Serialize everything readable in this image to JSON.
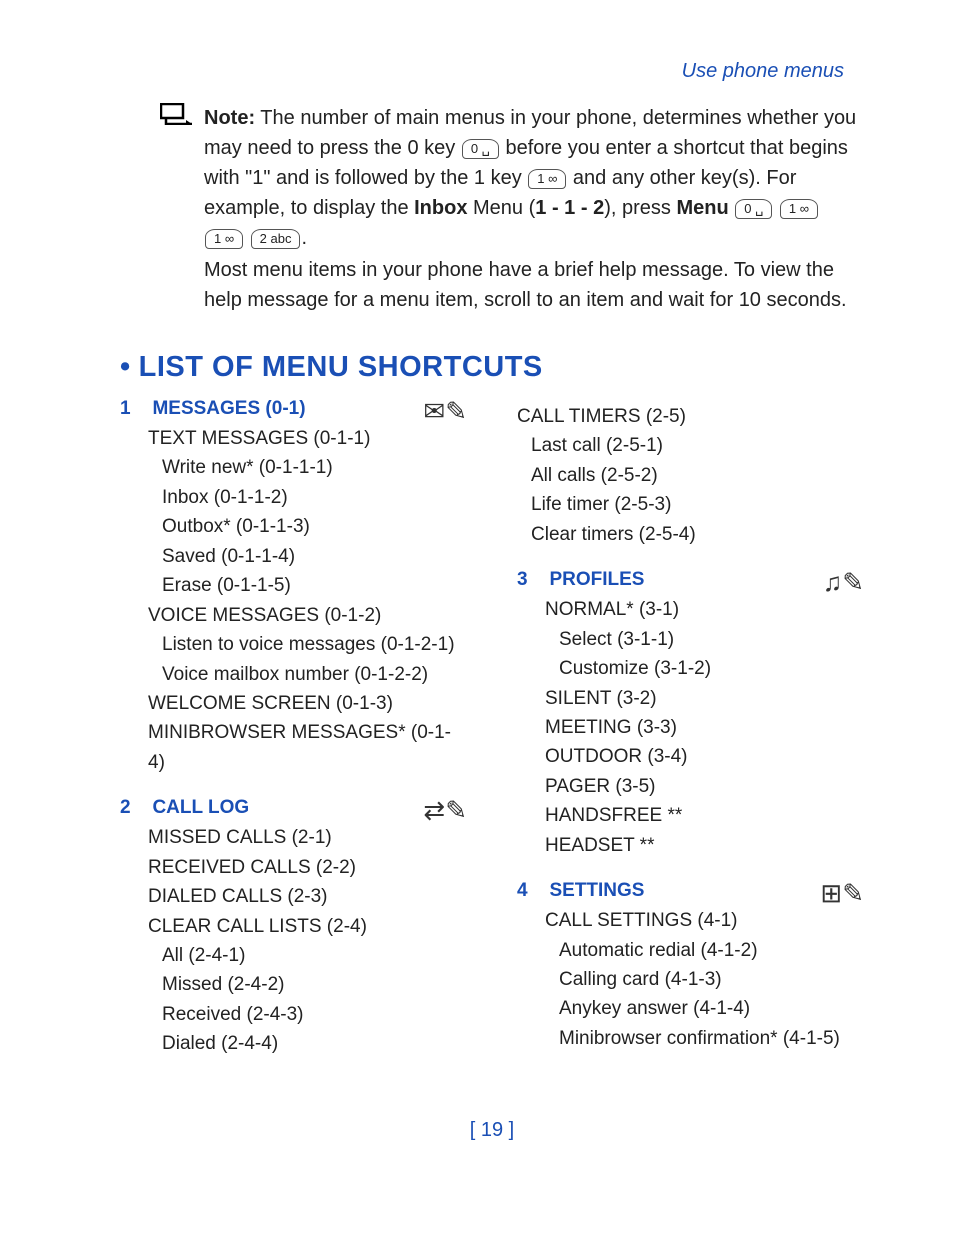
{
  "header": {
    "link": "Use phone menus"
  },
  "note": {
    "label": "Note:",
    "p1a": " The number of main menus in your phone, determines whether you may need to press the 0 key ",
    "key0": "0 ␣",
    "p1b": " before you enter a shortcut that begins with \"1\" and is followed by the 1 key ",
    "key1": "1 ∞",
    "p1c": " and any other key(s). For example, to display the ",
    "inbox": "Inbox",
    "p1d": " Menu (",
    "seq": "1 - 1 - 2",
    "p1e": "), press ",
    "menu": "Menu",
    "key0b": "0 ␣",
    "key1b": "1 ∞",
    "key1c": "1 ∞",
    "key2": "2 abc",
    "p1f": ".",
    "p2": "Most menu items in your phone have a brief help message. To view the help message for a menu item, scroll to an item and wait for 10 seconds."
  },
  "section": {
    "bullet": "•",
    "title": "LIST OF MENU SHORTCUTS"
  },
  "menus": {
    "messages": {
      "num": "1",
      "title": "MESSAGES (0-1)",
      "icon": "✉✎",
      "items": [
        {
          "txt": "TEXT MESSAGES (0-1-1)",
          "lvl": 1
        },
        {
          "txt": "Write new* (0-1-1-1)",
          "lvl": 2
        },
        {
          "txt": "Inbox (0-1-1-2)",
          "lvl": 2
        },
        {
          "txt": "Outbox* (0-1-1-3)",
          "lvl": 2
        },
        {
          "txt": "Saved (0-1-1-4)",
          "lvl": 2
        },
        {
          "txt": "Erase (0-1-1-5)",
          "lvl": 2
        },
        {
          "txt": "VOICE MESSAGES (0-1-2)",
          "lvl": 1
        },
        {
          "txt": "Listen to voice messages (0-1-2-1)",
          "lvl": 2
        },
        {
          "txt": "Voice mailbox number (0-1-2-2)",
          "lvl": 2
        },
        {
          "txt": "WELCOME SCREEN (0-1-3)",
          "lvl": 1
        },
        {
          "txt": "MINIBROWSER MESSAGES* (0-1-4)",
          "lvl": 1
        }
      ]
    },
    "calllog": {
      "num": "2",
      "title": "CALL LOG",
      "icon": "⇄✎",
      "items": [
        {
          "txt": "MISSED CALLS (2-1)",
          "lvl": 1
        },
        {
          "txt": "RECEIVED CALLS (2-2)",
          "lvl": 1
        },
        {
          "txt": "DIALED CALLS (2-3)",
          "lvl": 1
        },
        {
          "txt": "CLEAR CALL LISTS (2-4)",
          "lvl": 1
        },
        {
          "txt": "All (2-4-1)",
          "lvl": 2
        },
        {
          "txt": "Missed (2-4-2)",
          "lvl": 2
        },
        {
          "txt": "Received (2-4-3)",
          "lvl": 2
        },
        {
          "txt": "Dialed (2-4-4)",
          "lvl": 2
        }
      ]
    },
    "calltimers": {
      "items": [
        {
          "txt": "CALL TIMERS (2-5)",
          "lvl": 1
        },
        {
          "txt": "Last call (2-5-1)",
          "lvl": 2
        },
        {
          "txt": "All calls (2-5-2)",
          "lvl": 2
        },
        {
          "txt": "Life timer (2-5-3)",
          "lvl": 2
        },
        {
          "txt": "Clear timers (2-5-4)",
          "lvl": 2
        }
      ]
    },
    "profiles": {
      "num": "3",
      "title": "PROFILES",
      "icon": "♫✎",
      "items": [
        {
          "txt": "NORMAL* (3-1)",
          "lvl": 1
        },
        {
          "txt": "Select (3-1-1)",
          "lvl": 2
        },
        {
          "txt": "Customize (3-1-2)",
          "lvl": 2
        },
        {
          "txt": "SILENT (3-2)",
          "lvl": 1
        },
        {
          "txt": "MEETING (3-3)",
          "lvl": 1
        },
        {
          "txt": "OUTDOOR (3-4)",
          "lvl": 1
        },
        {
          "txt": "PAGER (3-5)",
          "lvl": 1
        },
        {
          "txt": "HANDSFREE **",
          "lvl": 1
        },
        {
          "txt": "HEADSET **",
          "lvl": 1
        }
      ]
    },
    "settings": {
      "num": "4",
      "title": "SETTINGS",
      "icon": "⊞✎",
      "items": [
        {
          "txt": "CALL SETTINGS (4-1)",
          "lvl": 1
        },
        {
          "txt": "Automatic redial (4-1-2)",
          "lvl": 2
        },
        {
          "txt": "Calling card (4-1-3)",
          "lvl": 2
        },
        {
          "txt": "Anykey answer (4-1-4)",
          "lvl": 2
        },
        {
          "txt": "Minibrowser confirmation* (4-1-5)",
          "lvl": 2
        }
      ]
    }
  },
  "page_num": "[ 19 ]"
}
